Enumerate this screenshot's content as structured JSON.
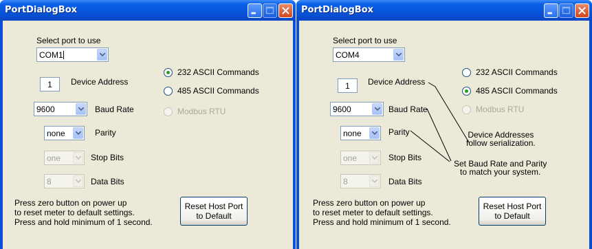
{
  "windows": [
    {
      "id": "left",
      "title": "PortDialogBox",
      "select_port_label": "Select port to use",
      "port": "COM1",
      "device_address": "1",
      "device_address_label": "Device Address",
      "radio_232": "232 ASCII Commands",
      "radio_485": "485 ASCII Commands",
      "radio_modbus": "Modbus RTU",
      "selected_protocol": "232 ASCII Commands",
      "baud": "9600",
      "baud_label": "Baud Rate",
      "parity": "none",
      "parity_label": "Parity",
      "stop_bits": "one",
      "stop_bits_label": "Stop Bits",
      "data_bits": "8",
      "data_bits_label": "Data Bits",
      "instructions": [
        "Press zero button on power up",
        "to reset meter to default settings.",
        "Press and hold minimum of 1 second."
      ],
      "reset_button": [
        "Reset Host Port",
        "to Default"
      ]
    },
    {
      "id": "right",
      "title": "PortDialogBox",
      "select_port_label": "Select port to use",
      "port": "COM4",
      "device_address": "1",
      "device_address_label": "Device Address",
      "radio_232": "232 ASCII Commands",
      "radio_485": "485 ASCII Commands",
      "radio_modbus": "Modbus RTU",
      "selected_protocol": "485 ASCII Commands",
      "baud": "9600",
      "baud_label": "Baud Rate",
      "parity": "none",
      "parity_label": "Parity",
      "stop_bits": "one",
      "stop_bits_label": "Stop Bits",
      "data_bits": "8",
      "data_bits_label": "Data Bits",
      "instructions": [
        "Press zero button on power up",
        "to reset meter to default settings.",
        "Press and hold minimum of 1 second."
      ],
      "reset_button": [
        "Reset Host Port",
        "to Default"
      ]
    }
  ],
  "annotations": {
    "address_note": [
      "Device Addresses",
      "follow serialization."
    ],
    "baud_note": [
      "Set Baud Rate and Parity",
      "to match your system."
    ]
  }
}
